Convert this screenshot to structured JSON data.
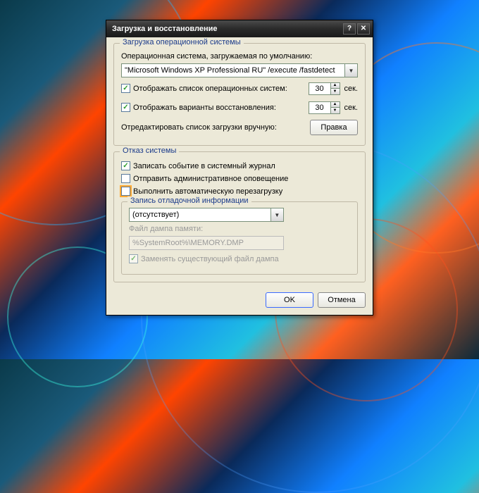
{
  "window": {
    "title": "Загрузка и восстановление"
  },
  "startup": {
    "legend": "Загрузка операционной системы",
    "default_os_label": "Операционная система, загружаемая по умолчанию:",
    "default_os_value": "\"Microsoft Windows XP Professional RU\" /execute /fastdetect",
    "show_os_list_label": "Отображать список операционных систем:",
    "show_os_list_value": "30",
    "show_recovery_label": "Отображать варианты восстановления:",
    "show_recovery_value": "30",
    "seconds_unit": "сек.",
    "edit_label": "Отредактировать список загрузки вручную:",
    "edit_button": "Правка"
  },
  "failure": {
    "legend": "Отказ системы",
    "write_event_label": "Записать событие в системный журнал",
    "admin_alert_label": "Отправить административное оповещение",
    "auto_restart_label": "Выполнить автоматическую перезагрузку"
  },
  "debug": {
    "legend": "Запись отладочной информации",
    "type_value": "(отсутствует)",
    "dump_file_label": "Файл дампа памяти:",
    "dump_file_value": "%SystemRoot%\\MEMORY.DMP",
    "overwrite_label": "Заменять существующий файл дампа"
  },
  "buttons": {
    "ok": "OK",
    "cancel": "Отмена"
  }
}
